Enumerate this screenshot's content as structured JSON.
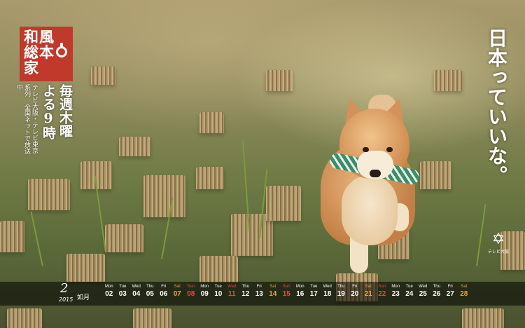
{
  "logo": {
    "line1": "和風",
    "line2": "総本家"
  },
  "network": "テレビ大阪・テレビ東京系列 全国ネットで放送中",
  "schedule": "毎週木曜 よる9時",
  "tagline": "日本っていいな。",
  "broadcaster": {
    "label": "テレビ大阪",
    "icon": "tv-osaka-logo-icon"
  },
  "calendar": {
    "month": "2",
    "year": "2015",
    "label": "如月",
    "days": [
      {
        "dow": "Mon",
        "num": "02",
        "type": "weekday"
      },
      {
        "dow": "Tue",
        "num": "03",
        "type": "weekday"
      },
      {
        "dow": "Wed",
        "num": "04",
        "type": "weekday"
      },
      {
        "dow": "Thu",
        "num": "05",
        "type": "weekday"
      },
      {
        "dow": "Fri",
        "num": "06",
        "type": "weekday"
      },
      {
        "dow": "Sat",
        "num": "07",
        "type": "sat"
      },
      {
        "dow": "Sun",
        "num": "08",
        "type": "sun"
      },
      {
        "dow": "Mon",
        "num": "09",
        "type": "weekday"
      },
      {
        "dow": "Tue",
        "num": "10",
        "type": "weekday"
      },
      {
        "dow": "Wed",
        "num": "11",
        "type": "sun"
      },
      {
        "dow": "Thu",
        "num": "12",
        "type": "weekday"
      },
      {
        "dow": "Fri",
        "num": "13",
        "type": "weekday"
      },
      {
        "dow": "Sat",
        "num": "14",
        "type": "sat"
      },
      {
        "dow": "Sun",
        "num": "15",
        "type": "sun"
      },
      {
        "dow": "Mon",
        "num": "16",
        "type": "weekday"
      },
      {
        "dow": "Tue",
        "num": "17",
        "type": "weekday"
      },
      {
        "dow": "Wed",
        "num": "18",
        "type": "weekday"
      },
      {
        "dow": "Thu",
        "num": "19",
        "type": "weekday"
      },
      {
        "dow": "Fri",
        "num": "20",
        "type": "weekday"
      },
      {
        "dow": "Sat",
        "num": "21",
        "type": "sat"
      },
      {
        "dow": "Sun",
        "num": "22",
        "type": "sun"
      },
      {
        "dow": "Mon",
        "num": "23",
        "type": "weekday"
      },
      {
        "dow": "Tue",
        "num": "24",
        "type": "weekday"
      },
      {
        "dow": "Wed",
        "num": "25",
        "type": "weekday"
      },
      {
        "dow": "Thu",
        "num": "26",
        "type": "weekday"
      },
      {
        "dow": "Fri",
        "num": "27",
        "type": "weekday"
      },
      {
        "dow": "Sat",
        "num": "28",
        "type": "sat"
      }
    ]
  }
}
